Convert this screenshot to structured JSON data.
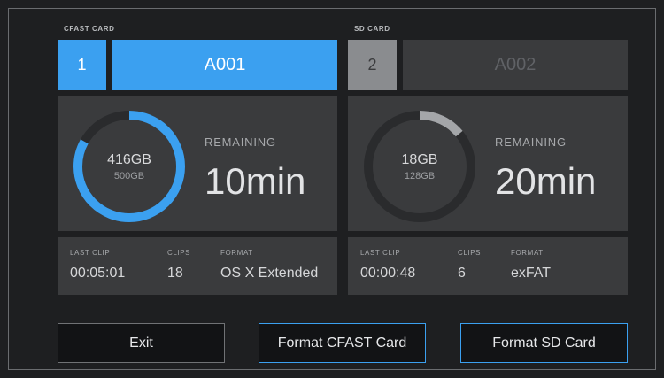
{
  "cards": [
    {
      "label": "CFAST CARD",
      "slot_number": "1",
      "clip_name": "A001",
      "active": true,
      "used": "416GB",
      "total": "500GB",
      "fill_fraction": 0.83,
      "ring_color": "#3ba0f0",
      "remaining_label": "REMAINING",
      "remaining_value": "10min",
      "last_clip_label": "LAST CLIP",
      "last_clip_value": "00:05:01",
      "clips_label": "CLIPS",
      "clips_value": "18",
      "format_label": "FORMAT",
      "format_value": "OS X Extended"
    },
    {
      "label": "SD CARD",
      "slot_number": "2",
      "clip_name": "A002",
      "active": false,
      "used": "18GB",
      "total": "128GB",
      "fill_fraction": 0.14,
      "ring_color": "#a4a6a9",
      "remaining_label": "REMAINING",
      "remaining_value": "20min",
      "last_clip_label": "LAST CLIP",
      "last_clip_value": "00:00:48",
      "clips_label": "CLIPS",
      "clips_value": "6",
      "format_label": "FORMAT",
      "format_value": "exFAT"
    }
  ],
  "buttons": {
    "exit": "Exit",
    "format_cfast": "Format CFAST Card",
    "format_sd": "Format SD Card"
  },
  "colors": {
    "accent": "#3ba0f0",
    "ring_track": "#2a2b2d"
  }
}
